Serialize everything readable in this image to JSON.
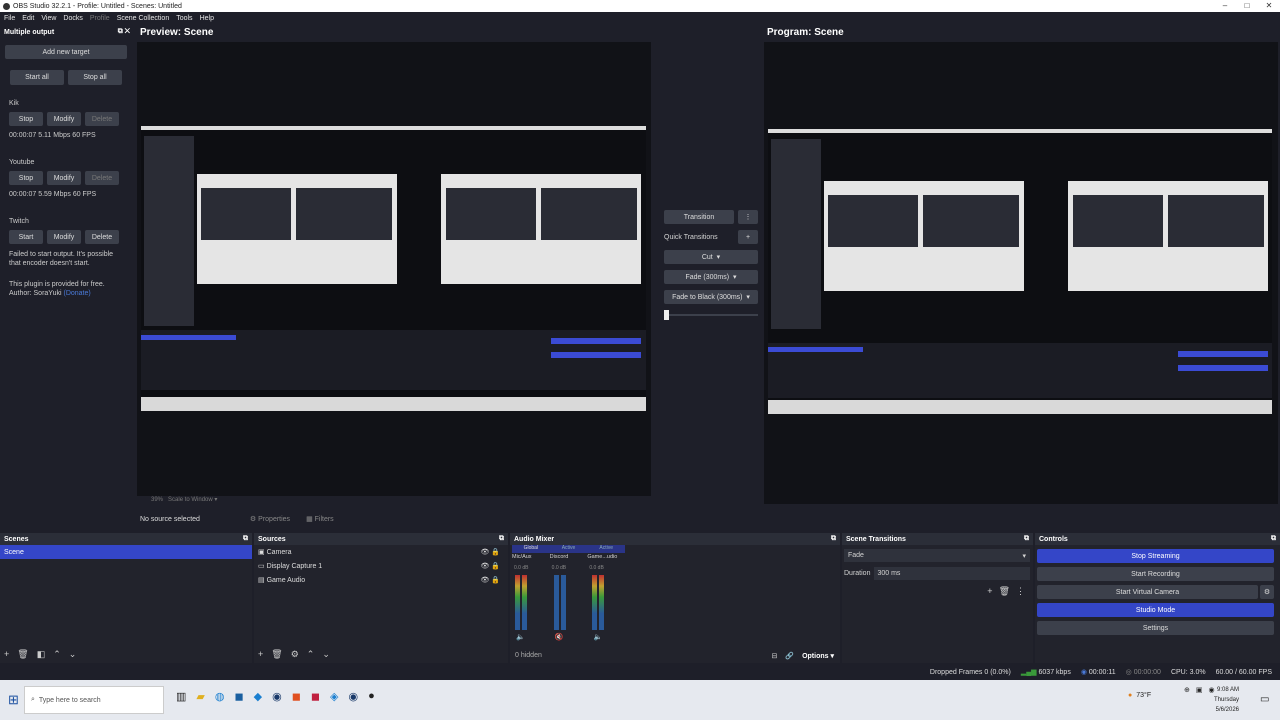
{
  "window": {
    "title": "OBS Studio 32.2.1 - Profile: Untitled - Scenes: Untitled",
    "minimize": "–",
    "maximize": "□",
    "close": "✕"
  },
  "menu": {
    "file": "File",
    "edit": "Edit",
    "view": "View",
    "docks": "Docks",
    "profile": "Profile",
    "scene_collection": "Scene Collection",
    "tools": "Tools",
    "help": "Help"
  },
  "multiple_output": {
    "title": "Multiple output",
    "add_new_target": "Add new target",
    "start_all": "Start all",
    "stop_all": "Stop all",
    "targets": [
      {
        "name": "Kik",
        "btn1": "Stop",
        "btn2": "Modify",
        "btn3": "Delete",
        "status": "00:00:07  5.11 Mbps  60 FPS"
      },
      {
        "name": "Youtube",
        "btn1": "Stop",
        "btn2": "Modify",
        "btn3": "Delete",
        "status": "00:00:07  5.59 Mbps  60 FPS"
      },
      {
        "name": "Twitch",
        "btn1": "Start",
        "btn2": "Modify",
        "btn3": "Delete",
        "status": "Failed to start output. It's possible that encoder doesn't start."
      }
    ],
    "footer": "This plugin is provided for free.",
    "author": "Author: SoraYuki",
    "donate": "(Donate)"
  },
  "preview": {
    "label": "Preview: Scene",
    "zoom": "39%",
    "scale": "Scale to Window"
  },
  "program": {
    "label": "Program: Scene"
  },
  "transitions_panel": {
    "transition": "Transition",
    "quick_transitions": "Quick Transitions",
    "cut": "Cut",
    "fade": "Fade (300ms)",
    "fade_black": "Fade to Black (300ms)"
  },
  "source_bar": {
    "no_source": "No source selected",
    "properties": "Properties",
    "filters": "Filters"
  },
  "scenes": {
    "title": "Scenes",
    "items": [
      "Scene"
    ]
  },
  "sources": {
    "title": "Sources",
    "items": [
      "Camera",
      "Display Capture 1",
      "Game Audio"
    ]
  },
  "audio_mixer": {
    "title": "Audio Mixer",
    "tabs": [
      "Global",
      "Active",
      "Active"
    ],
    "channels": [
      "Mic/Aux",
      "Discord",
      "Game...udio"
    ],
    "db": "0.0 dB",
    "hidden": "0 hidden",
    "options": "Options"
  },
  "scene_transitions": {
    "title": "Scene Transitions",
    "type": "Fade",
    "duration_label": "Duration",
    "duration_value": "300 ms"
  },
  "controls": {
    "title": "Controls",
    "stop_streaming": "Stop Streaming",
    "start_recording": "Start Recording",
    "start_virtual_camera": "Start Virtual Camera",
    "studio_mode": "Studio Mode",
    "settings": "Settings"
  },
  "status": {
    "dropped_frames": "Dropped Frames 0 (0.0%)",
    "kbps": "6037 kbps",
    "stream_time": "00:00:11",
    "rec_time": "00:00:00",
    "cpu": "CPU: 3.0%",
    "fps": "60.00 / 60.00 FPS"
  },
  "taskbar": {
    "search_placeholder": "Type here to search",
    "weather": "73°F",
    "time": "9:08 AM",
    "day": "Thursday",
    "date": "5/6/2026"
  },
  "colors": {
    "accent": "#3446c8",
    "background": "#1e1f29",
    "panel": "#2b2e38"
  }
}
